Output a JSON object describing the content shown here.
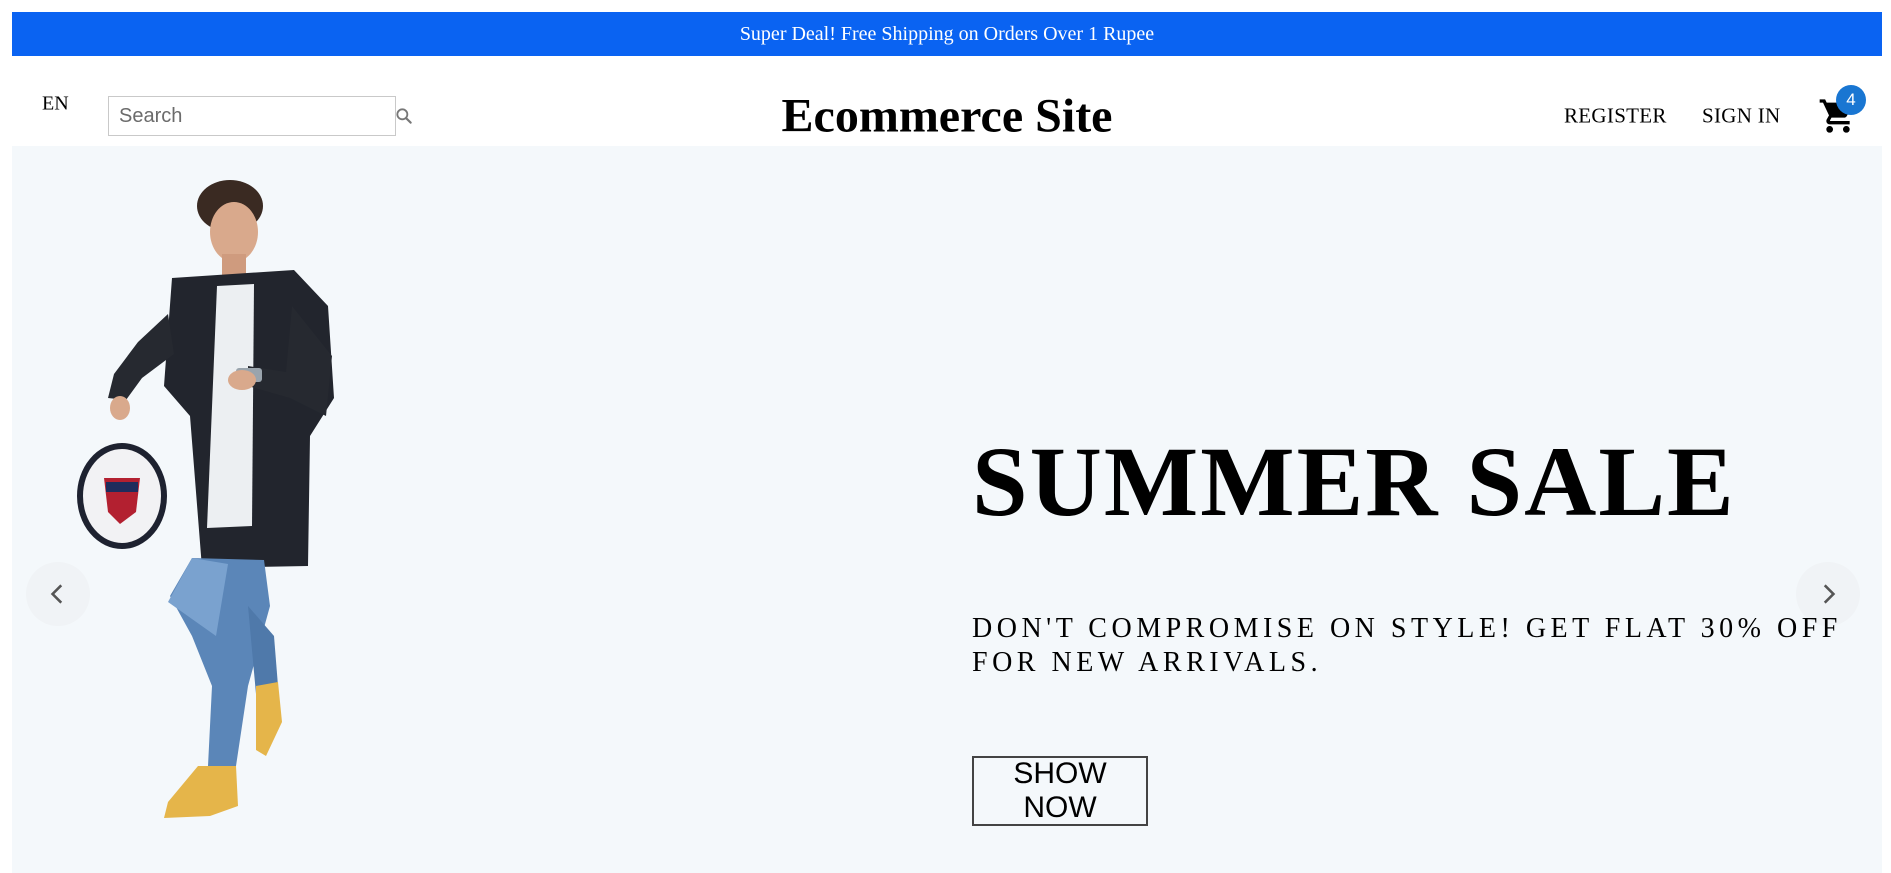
{
  "announcement": {
    "text": "Super Deal! Free Shipping on Orders Over 1 Rupee"
  },
  "header": {
    "language": "EN",
    "search": {
      "placeholder": "Search",
      "value": "",
      "icon": "search-icon"
    },
    "brand": "Ecommerce Site",
    "links": {
      "register": "REGISTER",
      "sign_in": "SIGN IN"
    },
    "cart": {
      "icon": "cart-icon",
      "count": "4"
    }
  },
  "hero": {
    "title": "SUMMER SALE",
    "description": "DON'T COMPROMISE ON STYLE! GET FLAT 30% OFF FOR NEW ARRIVALS.",
    "button_label": "SHOW NOW",
    "image": "model-photo",
    "prev_icon": "chevron-left-icon",
    "next_icon": "chevron-right-icon"
  },
  "colors": {
    "announcement_bg": "#0a63f2",
    "hero_bg": "#f4f8fb",
    "badge_bg": "#1976d2"
  }
}
